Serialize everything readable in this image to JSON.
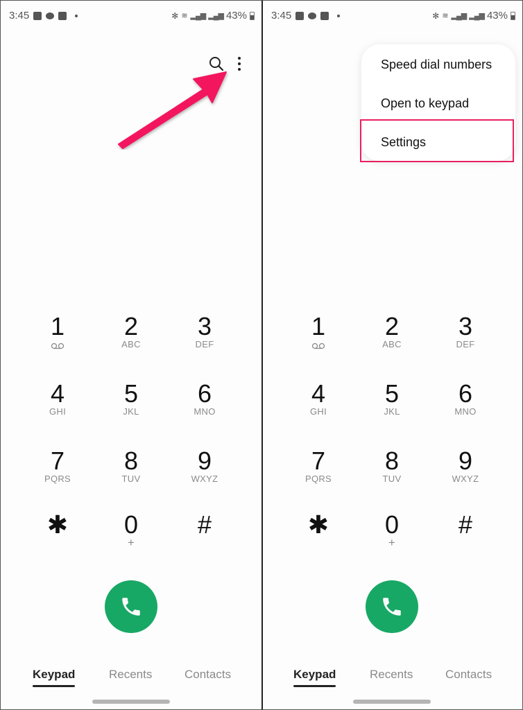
{
  "status_bar": {
    "time": "3:45",
    "left_icons": [
      "gallery-icon",
      "message-icon",
      "checkbox-icon",
      "dot-icon"
    ],
    "right_icons": [
      "bluetooth-icon",
      "wifi-icon",
      "signal-icon",
      "signal-icon"
    ],
    "battery": "43%"
  },
  "left_panel": {
    "toolbar": {
      "search_icon": "search-icon",
      "more_icon": "more-options-icon"
    },
    "annotation": {
      "type": "arrow",
      "color": "#f3165e",
      "points_to": "more-options-icon"
    }
  },
  "right_panel": {
    "menu": {
      "items": [
        {
          "label": "Speed dial numbers"
        },
        {
          "label": "Open to keypad"
        },
        {
          "label": "Settings",
          "highlighted": true
        }
      ],
      "highlight_color": "#ea1f5f"
    }
  },
  "keypad": {
    "keys": [
      {
        "digit": "1",
        "sub": "",
        "sub_icon": "voicemail-icon"
      },
      {
        "digit": "2",
        "sub": "ABC"
      },
      {
        "digit": "3",
        "sub": "DEF"
      },
      {
        "digit": "4",
        "sub": "GHI"
      },
      {
        "digit": "5",
        "sub": "JKL"
      },
      {
        "digit": "6",
        "sub": "MNO"
      },
      {
        "digit": "7",
        "sub": "PQRS"
      },
      {
        "digit": "8",
        "sub": "TUV"
      },
      {
        "digit": "9",
        "sub": "WXYZ"
      },
      {
        "digit": "✱",
        "sub": ""
      },
      {
        "digit": "0",
        "sub": "+"
      },
      {
        "digit": "#",
        "sub": ""
      }
    ],
    "call_button_color": "#18a865"
  },
  "tabs": [
    {
      "label": "Keypad",
      "active": true
    },
    {
      "label": "Recents",
      "active": false
    },
    {
      "label": "Contacts",
      "active": false
    }
  ]
}
